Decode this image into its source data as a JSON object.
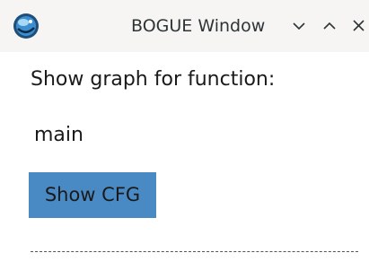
{
  "window": {
    "title": "BOGUE Window",
    "app_icon": "bogue-logo-icon",
    "controls": {
      "minimize_icon": "chevron-down-icon",
      "maximize_icon": "chevron-up-icon",
      "close_icon": "close-icon"
    }
  },
  "content": {
    "prompt_label": "Show graph for function:",
    "function_name": "main",
    "show_cfg_label": "Show CFG"
  },
  "colors": {
    "titlebar_bg": "#f6f5f4",
    "button_bg": "#4a8ac4",
    "text": "#1a1a1a"
  }
}
